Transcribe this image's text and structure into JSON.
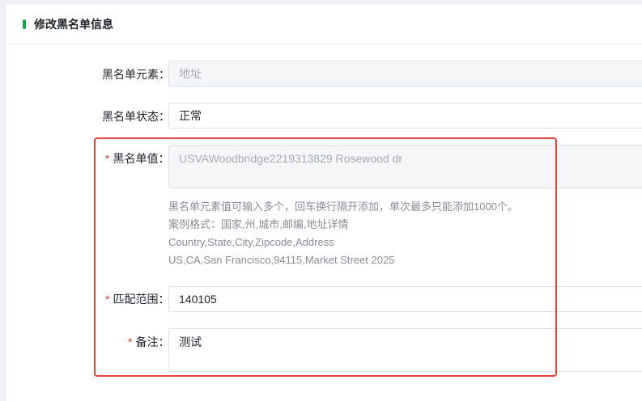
{
  "header": {
    "title": "修改黑名单信息"
  },
  "form": {
    "element": {
      "label": "黑名单元素：",
      "value": "地址"
    },
    "status": {
      "label": "黑名单状态：",
      "value": "正常"
    },
    "blacklist_value": {
      "required_mark": "*",
      "label": "黑名单值：",
      "value": "USVAWoodbridge2219313829 Rosewood dr"
    },
    "hints": [
      "黑名单元素值可输入多个，回车换行隔开添加，单次最多只能添加1000个。",
      "案例格式：国家,州,城市,邮编,地址详情",
      "Country,State,City,Zipcode,Address",
      "US,CA,San Francisco,94115,Market Street 2025"
    ],
    "match_range": {
      "required_mark": "*",
      "label": "匹配范围：",
      "value": "140105"
    },
    "remark": {
      "required_mark": "*",
      "label": "备注：",
      "value": "测试"
    }
  },
  "colors": {
    "accent": "#1aa34a",
    "required": "#e0403c",
    "highlight_border": "#e5403a"
  }
}
